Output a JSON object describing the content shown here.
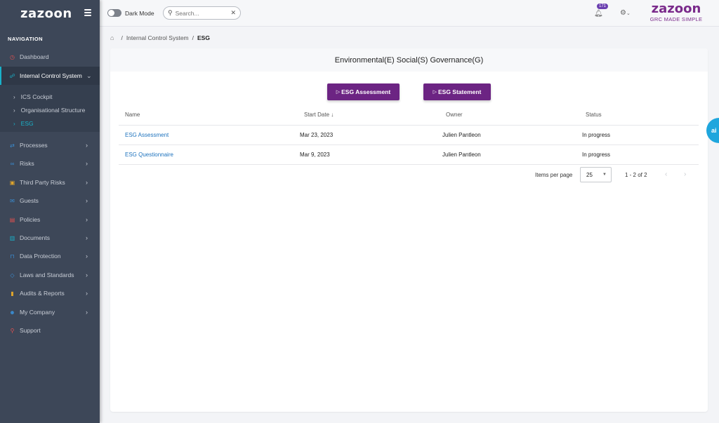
{
  "brand": {
    "logo": "zazoon"
  },
  "sidebar": {
    "nav_title": "NAVIGATION",
    "items": [
      {
        "label": "Dashboard",
        "icon": "dashboard-icon"
      },
      {
        "label": "Internal Control System",
        "icon": "network-icon"
      },
      {
        "label": "Processes",
        "icon": "processes-icon"
      },
      {
        "label": "Risks",
        "icon": "risks-icon"
      },
      {
        "label": "Third Party Risks",
        "icon": "package-icon"
      },
      {
        "label": "Guests",
        "icon": "mail-icon"
      },
      {
        "label": "Policies",
        "icon": "policy-icon"
      },
      {
        "label": "Documents",
        "icon": "document-icon"
      },
      {
        "label": "Data Protection",
        "icon": "lock-icon"
      },
      {
        "label": "Laws and Standards",
        "icon": "shield-icon"
      },
      {
        "label": "Audits & Reports",
        "icon": "bar-chart-icon"
      },
      {
        "label": "My Company",
        "icon": "people-icon"
      },
      {
        "label": "Support",
        "icon": "support-icon"
      }
    ],
    "submenu": [
      {
        "label": "ICS Cockpit"
      },
      {
        "label": "Organisational Structure"
      },
      {
        "label": "ESG"
      }
    ]
  },
  "topbar": {
    "dark_mode_label": "Dark Mode",
    "search_placeholder": "Search...",
    "notification_count": "171",
    "logo": "zazoon",
    "tagline": "GRC MADE SIMPLE"
  },
  "breadcrumb": {
    "parent": "Internal Control System",
    "current": "ESG"
  },
  "card": {
    "title": "Environmental(E) Social(S) Governance(G)",
    "buttons": {
      "assessment": "ESG Assessment",
      "statement": "ESG Statement"
    },
    "table": {
      "headers": [
        "Name",
        "Start Date",
        "Owner",
        "Status"
      ],
      "sort_indicator": "↓",
      "rows": [
        {
          "name": "ESG Assessment",
          "start_date": "Mar 23, 2023",
          "owner": "Julien Pantleon",
          "status": "In progress"
        },
        {
          "name": "ESG Questionnaire",
          "start_date": "Mar 9, 2023",
          "owner": "Julien Pantleon",
          "status": "In progress"
        }
      ]
    },
    "pagination": {
      "items_per_page_label": "Items per page",
      "page_size": "25",
      "range": "1 - 2 of 2"
    }
  },
  "ai_tab": {
    "label": "ai"
  },
  "colors": {
    "sidebar_bg": "#3d4758",
    "accent_teal": "#19b1c9",
    "brand_purple": "#6c2483",
    "link_blue": "#1e73be",
    "ai_blue": "#1ea6dd"
  }
}
